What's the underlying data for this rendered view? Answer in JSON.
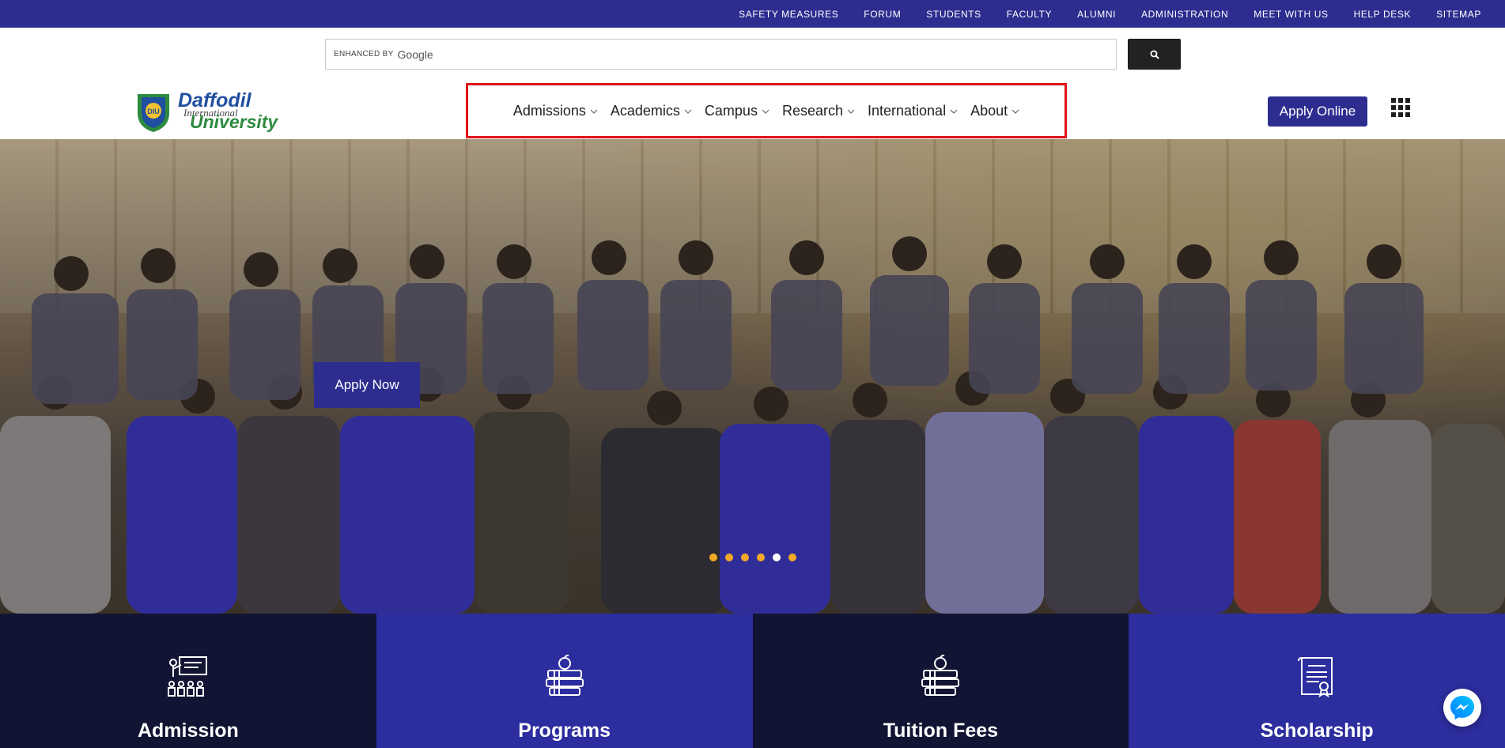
{
  "topbar": {
    "links": [
      "SAFETY MEASURES",
      "FORUM",
      "STUDENTS",
      "FACULTY",
      "ALUMNI",
      "ADMINISTRATION",
      "MEET WITH US",
      "HELP DESK",
      "SITEMAP"
    ]
  },
  "search": {
    "enhanced_label": "ENHANCED BY",
    "google_label": "Google",
    "value": ""
  },
  "logo": {
    "name_line1": "Daffodil",
    "name_line2": "International",
    "name_line3": "University",
    "badge": "DIU"
  },
  "nav": {
    "items": [
      {
        "label": "Admissions"
      },
      {
        "label": "Academics"
      },
      {
        "label": "Campus"
      },
      {
        "label": "Research"
      },
      {
        "label": "International"
      },
      {
        "label": "About"
      }
    ]
  },
  "header": {
    "apply_online": "Apply Online"
  },
  "hero": {
    "apply_now": "Apply Now",
    "slides": 6,
    "active_slide": 5
  },
  "tiles": [
    {
      "label": "Admission",
      "icon": "presentation-icon"
    },
    {
      "label": "Programs",
      "icon": "books-apple-icon"
    },
    {
      "label": "Tuition Fees",
      "icon": "books-apple-icon"
    },
    {
      "label": "Scholarship",
      "icon": "certificate-icon"
    }
  ],
  "colors": {
    "brand": "#2c2d8f",
    "highlight": "#e0151b",
    "dot": "#f3a927"
  }
}
